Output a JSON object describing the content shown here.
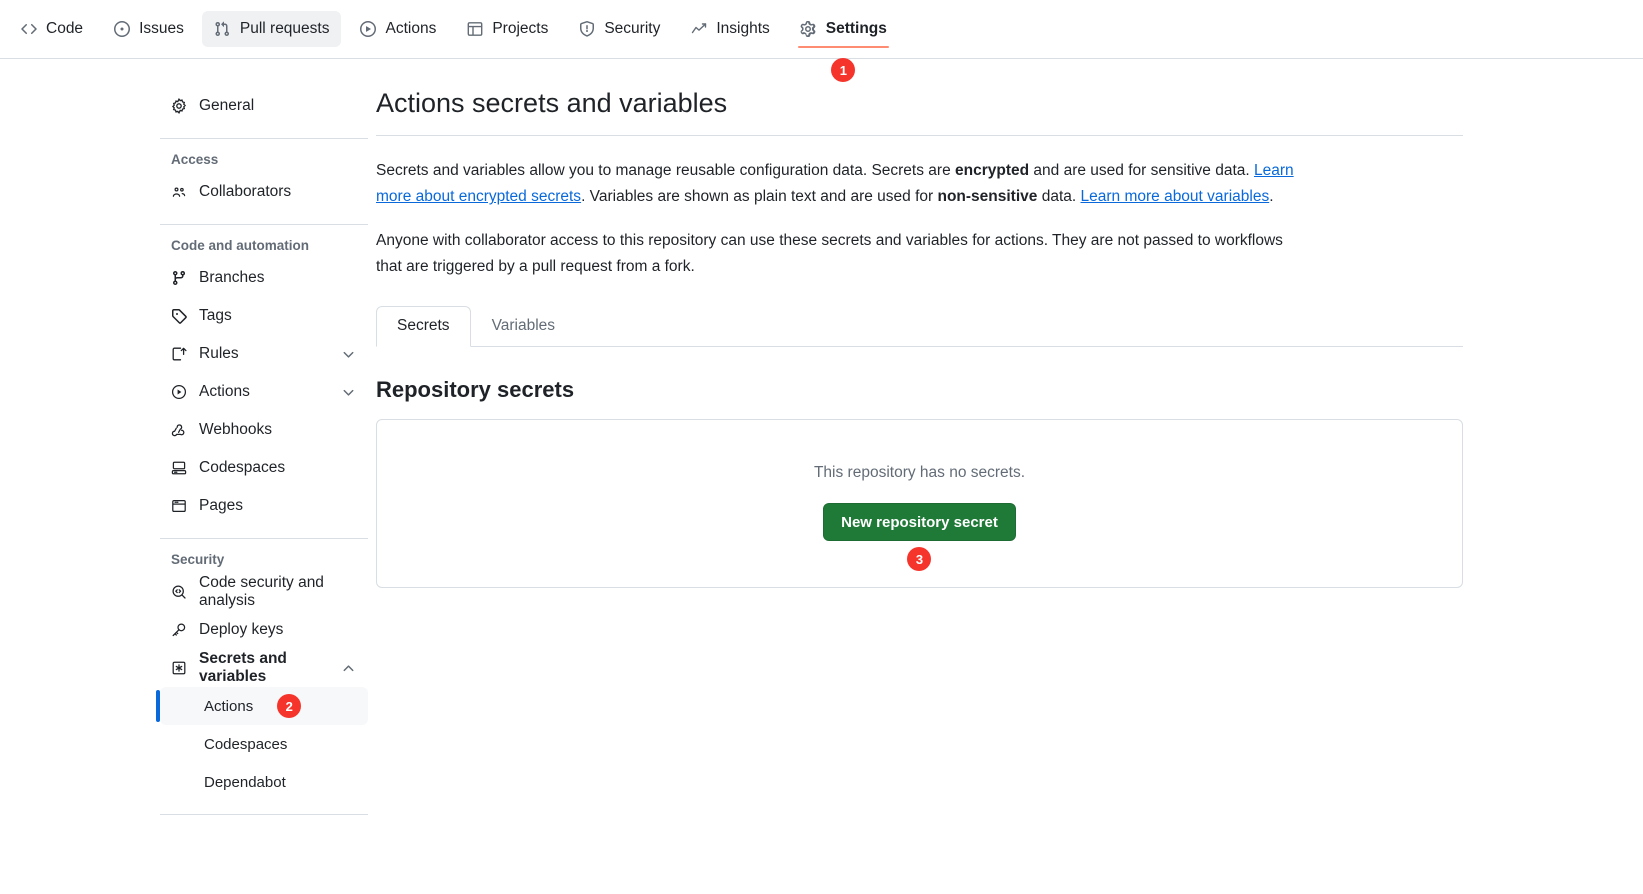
{
  "topnav": {
    "items": [
      {
        "label": "Code",
        "icon": "code-icon",
        "state": "default"
      },
      {
        "label": "Issues",
        "icon": "issue-opened-icon",
        "state": "default"
      },
      {
        "label": "Pull requests",
        "icon": "git-pull-request-icon",
        "state": "hovered"
      },
      {
        "label": "Actions",
        "icon": "play-icon",
        "state": "default"
      },
      {
        "label": "Projects",
        "icon": "table-icon",
        "state": "default"
      },
      {
        "label": "Security",
        "icon": "shield-icon",
        "state": "default"
      },
      {
        "label": "Insights",
        "icon": "graph-icon",
        "state": "default"
      },
      {
        "label": "Settings",
        "icon": "gear-icon",
        "state": "current"
      }
    ],
    "settings_badge": "1"
  },
  "sidebar": {
    "general": {
      "label": "General",
      "icon": "gear-icon"
    },
    "sections": [
      {
        "title": "Access",
        "items": [
          {
            "label": "Collaborators",
            "icon": "people-icon",
            "expandable": false
          }
        ]
      },
      {
        "title": "Code and automation",
        "items": [
          {
            "label": "Branches",
            "icon": "git-branch-icon",
            "expandable": false
          },
          {
            "label": "Tags",
            "icon": "tag-icon",
            "expandable": false
          },
          {
            "label": "Rules",
            "icon": "rules-icon",
            "expandable": true,
            "expanded": false
          },
          {
            "label": "Actions",
            "icon": "play-icon",
            "expandable": true,
            "expanded": false
          },
          {
            "label": "Webhooks",
            "icon": "webhook-icon",
            "expandable": false
          },
          {
            "label": "Codespaces",
            "icon": "codespaces-icon",
            "expandable": false
          },
          {
            "label": "Pages",
            "icon": "browser-icon",
            "expandable": false
          }
        ]
      },
      {
        "title": "Security",
        "items": [
          {
            "label": "Code security and analysis",
            "icon": "codescan-icon",
            "expandable": false
          },
          {
            "label": "Deploy keys",
            "icon": "key-icon",
            "expandable": false
          },
          {
            "label": "Secrets and variables",
            "icon": "asterisk-icon",
            "expandable": true,
            "expanded": true,
            "bold": true
          }
        ]
      }
    ],
    "sub_items": [
      {
        "label": "Actions",
        "active": true,
        "badge": "2"
      },
      {
        "label": "Codespaces",
        "active": false,
        "badge": ""
      },
      {
        "label": "Dependabot",
        "active": false,
        "badge": ""
      }
    ]
  },
  "main": {
    "title": "Actions secrets and variables",
    "paragraph1": {
      "p1": "Secrets and variables allow you to manage reusable configuration data. Secrets are ",
      "b1": "encrypted",
      "p2": " and are used for sensitive data. ",
      "link1": "Learn more about encrypted secrets",
      "p3": ". Variables are shown as plain text and are used for ",
      "b2": "non-sensitive",
      "p4": " data. ",
      "link2": "Learn more about variables",
      "p5": "."
    },
    "paragraph2": "Anyone with collaborator access to this repository can use these secrets and variables for actions. They are not passed to workflows that are triggered by a pull request from a fork.",
    "tabs": [
      {
        "label": "Secrets",
        "active": true
      },
      {
        "label": "Variables",
        "active": false
      }
    ],
    "section_heading": "Repository secrets",
    "empty_state_text": "This repository has no secrets.",
    "new_secret_button": "New repository secret",
    "new_secret_badge": "3"
  },
  "colors": {
    "accent_blue": "#0969da",
    "badge_red": "#f5352c",
    "button_green": "#1f7a37",
    "tab_underline_orange": "#fd8c73",
    "border_gray": "#d8dee4",
    "muted_text": "#636c76"
  }
}
